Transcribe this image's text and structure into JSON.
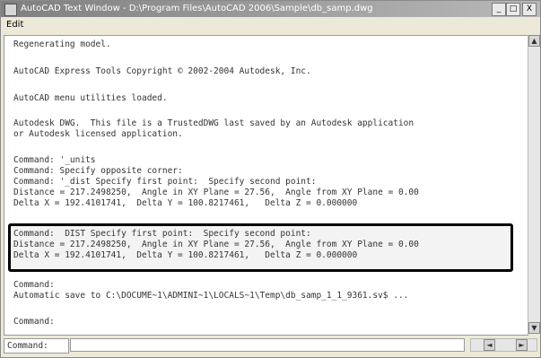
{
  "window": {
    "title": "AutoCAD Text Window - D:\\Program Files\\AutoCAD 2006\\Sample\\db_samp.dwg",
    "minimize": "_",
    "maximize": "□",
    "close": "X"
  },
  "menu": {
    "edit": "Edit"
  },
  "console": {
    "lines": [
      "Regenerating model.",
      "AutoCAD Express Tools Copyright © 2002-2004 Autodesk, Inc.",
      "AutoCAD menu utilities loaded.",
      "Autodesk DWG.  This file is a TrustedDWG last saved by an Autodesk application",
      "or Autodesk licensed application.",
      "Command: '_units",
      "Command: Specify opposite corner:",
      "Command: '_dist Specify first point:  Specify second point:",
      "Distance = 217.2498250,  Angle in XY Plane = 27.56,  Angle from XY Plane = 0.00",
      "Delta X = 192.4101741,  Delta Y = 100.8217461,   Delta Z = 0.000000",
      "Command:  DIST Specify first point:  Specify second point:",
      "Distance = 217.2498250,  Angle in XY Plane = 27.56,  Angle from XY Plane = 0.00",
      "Delta X = 192.4101741,  Delta Y = 100.8217461,   Delta Z = 0.000000",
      "Command:",
      "Automatic save to C:\\DOCUME~1\\ADMINI~1\\LOCALS~1\\Temp\\db_samp_1_1_9361.sv$ ...",
      "Command:"
    ]
  },
  "command": {
    "label": "Command:",
    "value": ""
  },
  "scroll": {
    "up": "▲",
    "down": "▼",
    "left": "◄",
    "right": "►"
  }
}
